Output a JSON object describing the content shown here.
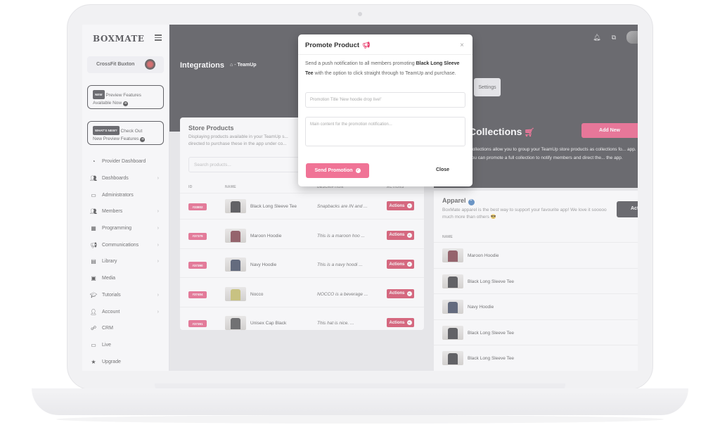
{
  "sidebar": {
    "logo": "BOXMATE",
    "gym_name": "CrossFit Buxton",
    "promo1": {
      "badge": "NEW",
      "line1": "Preview Features",
      "line2": "Available Now"
    },
    "promo2": {
      "badge": "WHAT'S NEW?",
      "line1": "Check Out",
      "line2": "New Preview Features"
    },
    "items": [
      {
        "label": "Provider Dashboard",
        "icon": "gauge-icon",
        "chev": false
      },
      {
        "label": "Dashboards",
        "icon": "users-icon",
        "chev": true
      },
      {
        "label": "Administrators",
        "icon": "admin-icon",
        "chev": false
      },
      {
        "label": "Members",
        "icon": "members-icon",
        "chev": true
      },
      {
        "label": "Programming",
        "icon": "calendar-icon",
        "chev": true
      },
      {
        "label": "Communications",
        "icon": "megaphone-icon",
        "chev": true
      },
      {
        "label": "Library",
        "icon": "library-icon",
        "chev": true
      },
      {
        "label": "Media",
        "icon": "media-icon",
        "chev": false
      },
      {
        "label": "Tutorials",
        "icon": "graduation-cap-icon",
        "chev": true
      },
      {
        "label": "Account",
        "icon": "account-icon",
        "chev": true
      },
      {
        "label": "CRM",
        "icon": "crm-icon",
        "chev": false
      },
      {
        "label": "Live",
        "icon": "monitor-icon",
        "chev": false
      },
      {
        "label": "Upgrade",
        "icon": "star-icon",
        "chev": false
      }
    ]
  },
  "header": {
    "title": "Integrations",
    "breadcrumb_sep": "-",
    "breadcrumb": "TeamUp",
    "settings": "Settings"
  },
  "store": {
    "title": "Store Products",
    "subtitle": "Displaying products available in your TeamUp s... directed to purchase these in the app under co...",
    "search_placeholder": "Search products...",
    "columns": {
      "id": "ID",
      "name": "NAME",
      "description": "DESCRIPTION",
      "actions": "ACTIONS"
    },
    "rows": [
      {
        "id": "#33802",
        "name": "Black Long Sleeve Tee",
        "desc": "Snapbacks are IN and ...",
        "action": "Actions",
        "color": "#1d1d20"
      },
      {
        "id": "#37379",
        "name": "Maroon Hoodie",
        "desc": "This is a maroon hoo ...",
        "action": "Actions",
        "color": "#6b1f2a"
      },
      {
        "id": "#37390",
        "name": "Navy Hoodie",
        "desc": "This is a navy hoodi ...",
        "action": "Actions",
        "color": "#1f2a44"
      },
      {
        "id": "#37404",
        "name": "Nocco",
        "desc": "NOCCO is a beverage ...",
        "action": "Actions",
        "color": "#b8b04a"
      },
      {
        "id": "#37391",
        "name": "Unisex Cap Black",
        "desc": "This hat is nice. ...",
        "action": "Actions",
        "color": "#333333"
      }
    ]
  },
  "collections": {
    "title": "Collections",
    "add_new": "Add New",
    "desc": "Collections allow you to group your TeamUp store products as collections fo... app. You can promote a full collection to notify members and direct the... the app."
  },
  "apparel": {
    "title": "Apparel",
    "desc": "BoxMate apparel is the best way to support your favourite app! We love it sooooo much more than others 😎",
    "action": "Act",
    "name_header": "NAME",
    "rows": [
      {
        "name": "Maroon Hoodie",
        "color": "#6b1f2a"
      },
      {
        "name": "Black Long Sleeve Tee",
        "color": "#1d1d20"
      },
      {
        "name": "Navy Hoodie",
        "color": "#1f2a44"
      },
      {
        "name": "Black Long Sleeve Tee",
        "color": "#1d1d20"
      },
      {
        "name": "Black Long Sleeve Tee",
        "color": "#1d1d20"
      }
    ]
  },
  "modal": {
    "title": "Promote Product",
    "close_x": "×",
    "body_pre": "Send a push notification to all members promoting ",
    "product": "Black Long Sleeve Tee",
    "body_post": " with the option to click straight through to TeamUp and purchase.",
    "title_placeholder": "Promotion Title 'New hoodie drop live!'",
    "content_placeholder": "Main content for the promotion notification...",
    "send": "Send Promotion",
    "close": "Close"
  },
  "colors": {
    "accent": "#e83d6d",
    "dark": "#2a2a2e",
    "action": "#cc2545"
  }
}
